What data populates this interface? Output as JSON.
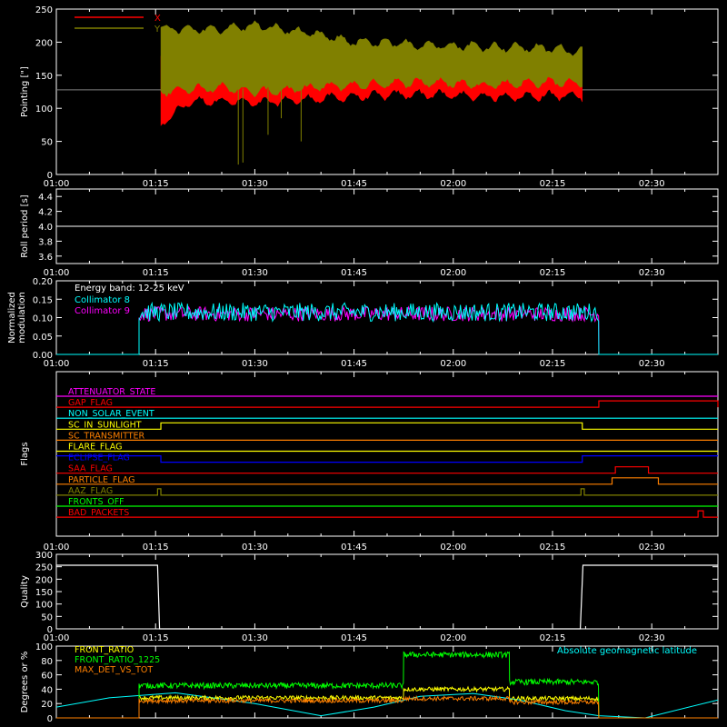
{
  "colors": {
    "background": "#000000",
    "axes": "#ffffff",
    "x_red": "#ff0000",
    "y_olive": "#808000",
    "cyan": "#00ffff",
    "magenta": "#ff00ff",
    "green": "#00ff00",
    "yellow": "#ffff00",
    "orange": "#ff8000",
    "blue": "#0000ff"
  },
  "time_axis": {
    "range_min": [
      60,
      160
    ],
    "tick_labels": [
      "01:00",
      "01:15",
      "01:30",
      "01:45",
      "02:00",
      "02:15",
      "02:30"
    ],
    "tick_minutes": [
      60,
      75,
      90,
      105,
      120,
      135,
      150
    ]
  },
  "chart_data": [
    {
      "id": "pointing",
      "type": "area",
      "title": "",
      "xlabel": "",
      "ylabel": "Pointing [\"]",
      "ylim": [
        0,
        250
      ],
      "yticks": [
        "0",
        "50",
        "100",
        "150",
        "200",
        "250"
      ],
      "legend_placement": "top-left",
      "series": [
        {
          "name": "X",
          "color": "#ff0000",
          "x_min": [
            75.8,
            80,
            85,
            90,
            95,
            100,
            105,
            110,
            115,
            120,
            125,
            130,
            135,
            139.5
          ],
          "lower": [
            75,
            110,
            112,
            108,
            112,
            115,
            118,
            120,
            122,
            120,
            118,
            118,
            120,
            118
          ],
          "upper": [
            178,
            180,
            178,
            176,
            174,
            172,
            172,
            170,
            172,
            172,
            174,
            175,
            176,
            176
          ]
        },
        {
          "name": "Y",
          "color": "#808000",
          "x_min": [
            75.8,
            80,
            85,
            90,
            95,
            100,
            105,
            110,
            115,
            120,
            125,
            130,
            135,
            139.5
          ],
          "lower": [
            125,
            130,
            132,
            125,
            128,
            133,
            135,
            138,
            140,
            138,
            136,
            138,
            140,
            138
          ],
          "upper": [
            222,
            218,
            220,
            225,
            218,
            210,
            200,
            198,
            196,
            195,
            193,
            192,
            190,
            186
          ]
        }
      ],
      "baseline": 128,
      "spikes_down_min": [
        [
          87.5,
          15
        ],
        [
          88.2,
          18
        ],
        [
          92,
          60
        ],
        [
          94,
          85
        ],
        [
          97,
          50
        ]
      ]
    },
    {
      "id": "roll_period",
      "type": "line",
      "ylabel": "Roll period [s]",
      "ylim": [
        3.5,
        4.5
      ],
      "yticks": [
        "3.6",
        "3.8",
        "4.0",
        "4.2",
        "4.4"
      ],
      "series": [
        {
          "name": "",
          "value": 4.0,
          "color": "#ffffff"
        }
      ]
    },
    {
      "id": "modulation",
      "type": "line",
      "ylabel": "Normalized modulation",
      "ylim": [
        0,
        0.2
      ],
      "yticks": [
        "0.00",
        "0.05",
        "0.10",
        "0.15",
        "0.20"
      ],
      "annotation": "Energy band: 12-25 keV",
      "start_min": 72.5,
      "end_min": 142,
      "series": [
        {
          "name": "Collimator 8",
          "color": "#00ffff",
          "mean": 0.115,
          "spread": 0.025
        },
        {
          "name": "Collimator 9",
          "color": "#ff00ff",
          "mean": 0.11,
          "spread": 0.02
        }
      ]
    },
    {
      "id": "flags",
      "type": "line",
      "ylabel": "Flags",
      "series": [
        {
          "name": "ATTENUATOR_STATE",
          "color": "#ff00ff",
          "on_intervals": []
        },
        {
          "name": "GAP_FLAG",
          "color": "#ff0000",
          "on_intervals": [
            [
              142,
              160
            ]
          ]
        },
        {
          "name": "NON_SOLAR_EVENT",
          "color": "#00ffff",
          "on_intervals": []
        },
        {
          "name": "SC_IN_SUNLIGHT",
          "color": "#ffff00",
          "on_intervals": [
            [
              75.8,
              139.5
            ]
          ]
        },
        {
          "name": "SC_TRANSMITTER",
          "color": "#ff8000",
          "on_intervals": []
        },
        {
          "name": "FLARE_FLAG",
          "color": "#ffff00",
          "on_intervals": []
        },
        {
          "name": "ECLIPSE_FLAG",
          "color": "#0000ff",
          "on_intervals": [
            [
              60,
              75.8
            ],
            [
              139.5,
              160
            ]
          ]
        },
        {
          "name": "SAA_FLAG",
          "color": "#ff0000",
          "on_intervals": [
            [
              144.5,
              149.5
            ]
          ]
        },
        {
          "name": "PARTICLE_FLAG",
          "color": "#ff8000",
          "on_intervals": [
            [
              144,
              151
            ]
          ]
        },
        {
          "name": "AAZ_FLAG",
          "color": "#808000",
          "on_intervals": [
            [
              75.3,
              75.8
            ],
            [
              139.3,
              139.8
            ]
          ]
        },
        {
          "name": "FRONTS_OFF",
          "color": "#00ff00",
          "on_intervals": []
        },
        {
          "name": "BAD_PACKETS",
          "color": "#ff0000",
          "on_intervals": [
            [
              157,
              157.8
            ]
          ]
        }
      ]
    },
    {
      "id": "quality",
      "type": "line",
      "ylabel": "Quality",
      "ylim": [
        0,
        300
      ],
      "yticks": [
        "0",
        "50",
        "100",
        "150",
        "200",
        "250",
        "300"
      ],
      "series": [
        {
          "name": "",
          "color": "#ffffff",
          "x_min": [
            60,
            75.3,
            75.6,
            76,
            139.2,
            139.6,
            160
          ],
          "values": [
            256,
            256,
            0,
            0,
            0,
            256,
            256
          ]
        }
      ]
    },
    {
      "id": "ratios",
      "type": "line",
      "ylabel": "Degrees or %",
      "ylim": [
        0,
        100
      ],
      "yticks": [
        "0",
        "20",
        "40",
        "60",
        "80",
        "100"
      ],
      "series": [
        {
          "name": "FRONT_RATIO",
          "color": "#ffff00",
          "segments": [
            [
              72.5,
              112.5,
              28
            ],
            [
              112.5,
              128.5,
              40
            ],
            [
              128.5,
              142,
              27
            ]
          ]
        },
        {
          "name": "FRONT_RATIO_1225",
          "color": "#00ff00",
          "segments": [
            [
              72.5,
              112.5,
              45
            ],
            [
              112.5,
              128.5,
              88
            ],
            [
              128.5,
              142,
              50
            ]
          ]
        },
        {
          "name": "MAX_DET_VS_TOT",
          "color": "#ff8000",
          "segments": [
            [
              72.5,
              112.5,
              24
            ],
            [
              112.5,
              128.5,
              27
            ],
            [
              128.5,
              142,
              22
            ]
          ]
        },
        {
          "name": "Absolute geomagnetic latitude",
          "color": "#00ffff",
          "x_min": [
            60,
            68,
            78,
            90,
            100,
            108,
            115,
            123,
            130,
            137,
            142,
            149,
            160
          ],
          "values": [
            15,
            28,
            35,
            20,
            3,
            15,
            30,
            34,
            25,
            10,
            3,
            0,
            25
          ]
        }
      ]
    }
  ]
}
